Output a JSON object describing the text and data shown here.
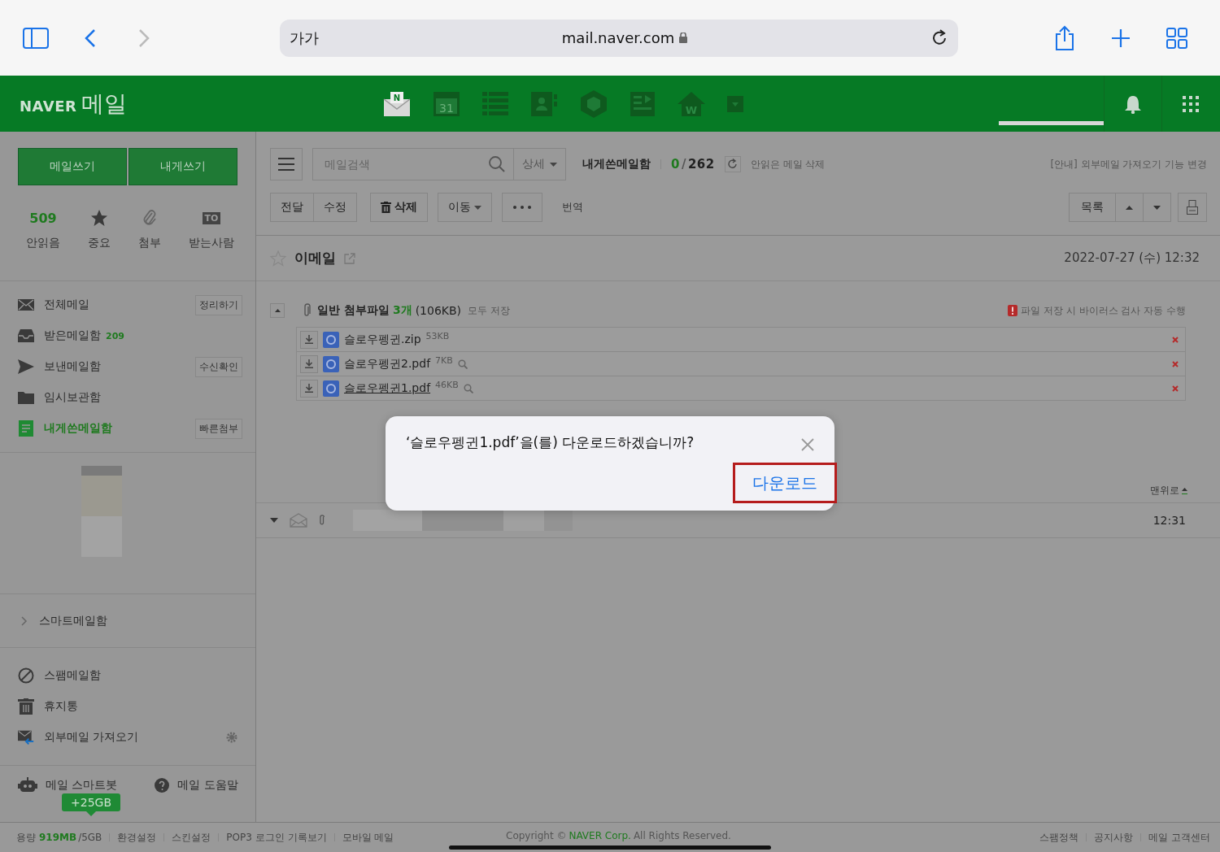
{
  "browser": {
    "text_size": "가가",
    "url": "mail.naver.com"
  },
  "header": {
    "logo_brand": "NAVER",
    "logo_service": "메일",
    "apps": [
      {
        "kind": "mail",
        "mark": "N"
      },
      {
        "kind": "calendar",
        "mark": "31"
      },
      {
        "kind": "list"
      },
      {
        "kind": "contacts"
      },
      {
        "kind": "cube"
      },
      {
        "kind": "memo"
      },
      {
        "kind": "home",
        "mark": "W"
      },
      {
        "kind": "more"
      }
    ]
  },
  "sidebar": {
    "compose_buttons": [
      "메일쓰기",
      "내게쓰기"
    ],
    "quick": [
      {
        "kind": "unread",
        "count": "509",
        "label": "안읽음"
      },
      {
        "kind": "star",
        "label": "중요"
      },
      {
        "kind": "clip",
        "label": "첨부"
      },
      {
        "kind": "to",
        "mark": "TO",
        "label": "받는사람"
      }
    ],
    "folders": [
      {
        "kind": "all",
        "label": "전체메일",
        "action": "정리하기",
        "selected": false
      },
      {
        "kind": "inbox",
        "label": "받은메일함",
        "count": "209",
        "selected": false
      },
      {
        "kind": "sent",
        "label": "보낸메일함",
        "action": "수신확인",
        "selected": false
      },
      {
        "kind": "draft",
        "label": "임시보관함",
        "selected": false
      },
      {
        "kind": "self",
        "label": "내게쓴메일함",
        "action": "빠른첨부",
        "selected": true
      }
    ],
    "smart_folder": {
      "label": "스마트메일함",
      "expanded": false
    },
    "other_folders": [
      {
        "kind": "spam",
        "label": "스팸메일함",
        "has_settings": false
      },
      {
        "kind": "trash",
        "label": "휴지통",
        "has_settings": false
      },
      {
        "kind": "import",
        "label": "외부메일 가져오기",
        "has_settings": true
      }
    ],
    "bot": "메일 스마트봇",
    "help": "메일 도움말",
    "storage_badge": "+25GB"
  },
  "toolbar": {
    "search_placeholder": "메일검색",
    "detail": "상세",
    "folder": "내게쓴메일함",
    "read_count": "0",
    "count_separator": "/",
    "total_count": "262",
    "unread_delete": "안읽은 메일 삭제",
    "notice": "[안내] 외부메일 가져오기 기능 변경",
    "actions": [
      {
        "kind": "group",
        "labels": [
          "전달",
          "수정"
        ]
      },
      {
        "kind": "delete",
        "labels": [
          "삭제"
        ]
      },
      {
        "kind": "dropdown",
        "labels": [
          "이동"
        ]
      },
      {
        "kind": "more"
      },
      {
        "kind": "link",
        "labels": [
          "번역"
        ]
      }
    ],
    "list_button": "목록"
  },
  "mail": {
    "subject": "이메일",
    "starred": false,
    "date": "2022-07-27 (수) 12:32",
    "attachments": {
      "title": "일반 첨부파일",
      "count": "3개",
      "size": "(106KB)",
      "save_all": "모두 저장",
      "virus_note": "파일 저장 시 바이러스 검사 자동 수행",
      "expanded": true,
      "files": [
        {
          "name": "슬로우펭귄.zip",
          "size": "53KB",
          "preview": false,
          "selected": false
        },
        {
          "name": "슬로우펭귄2.pdf",
          "size": "7KB",
          "preview": true,
          "selected": false
        },
        {
          "name": "슬로우펭귄1.pdf",
          "size": "46KB",
          "preview": true,
          "selected": true
        }
      ]
    },
    "to_top": "맨위로",
    "thread_time": "12:31"
  },
  "footer": {
    "storage_label": "용량",
    "storage_used": "919MB",
    "storage_total": "/5GB",
    "links": [
      "환경설정",
      "스킨설정",
      "POP3 로그인 기록보기",
      "모바일 메일"
    ],
    "copyright_pre": "Copyright ©",
    "copyright_corp": "NAVER Corp.",
    "copyright_post": "All Rights Reserved.",
    "right_links": [
      "스팸정책",
      "공지사항",
      "메일 고객센터"
    ]
  },
  "dialog": {
    "message": "‘슬로우펭귄1.pdf’을(를) 다운로드하겠습니까?",
    "button": "다운로드",
    "button_focused": true
  }
}
